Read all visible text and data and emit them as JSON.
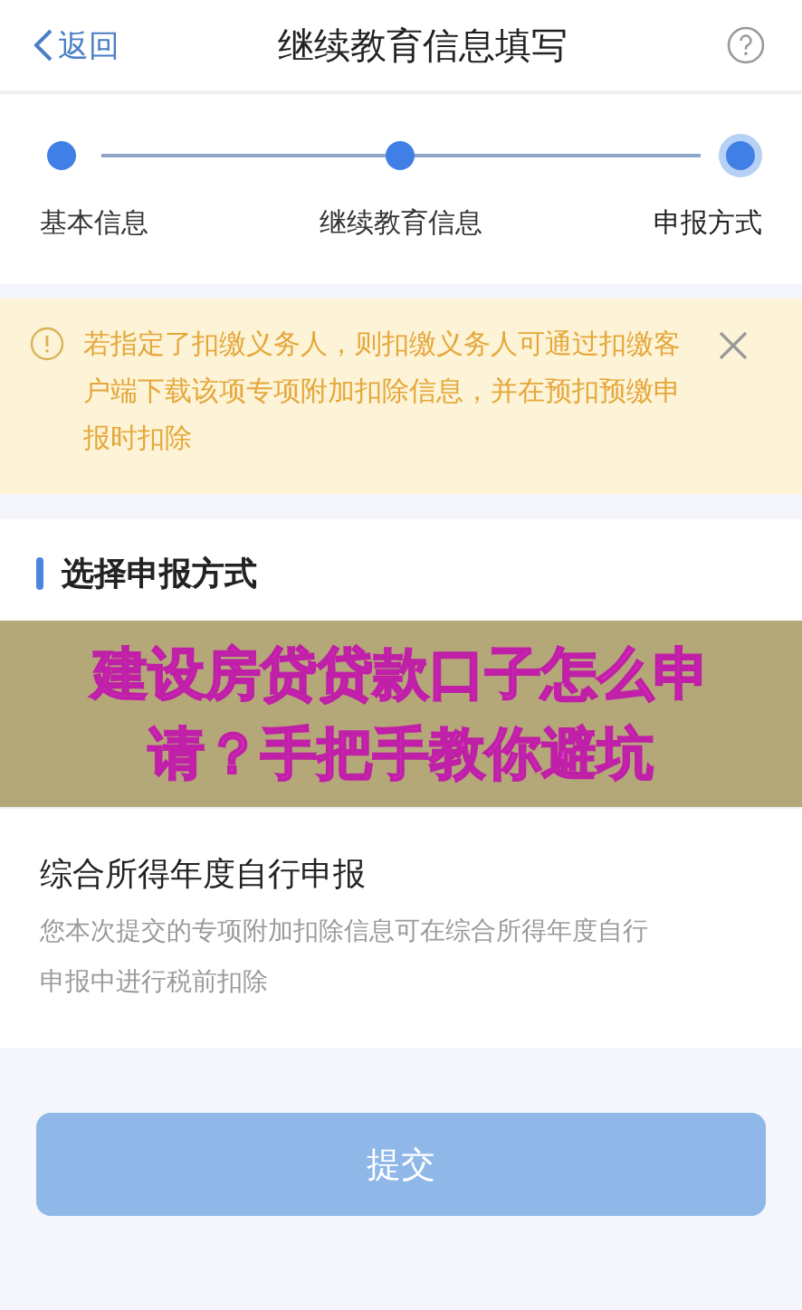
{
  "header": {
    "back": "返回",
    "title": "继续教育信息填写"
  },
  "steps": [
    {
      "label": "基本信息",
      "selected": false
    },
    {
      "label": "继续教育信息",
      "selected": false
    },
    {
      "label": "申报方式",
      "selected": true
    }
  ],
  "notice": {
    "text": "若指定了扣缴义务人，则扣缴义务人可通过扣缴客户端下载该项专项附加扣除信息，并在预扣预缴申报时扣除"
  },
  "section": {
    "title": "选择申报方式"
  },
  "banner": {
    "text": "建设房贷贷款口子怎么申请？手把手教你避坑"
  },
  "options": [
    {
      "title": "综合所得年度自行申报",
      "description": "您本次提交的专项附加扣除信息可在综合所得年度自行申报中进行税前扣除"
    }
  ],
  "submit": {
    "label": "提交",
    "disabled": true
  }
}
